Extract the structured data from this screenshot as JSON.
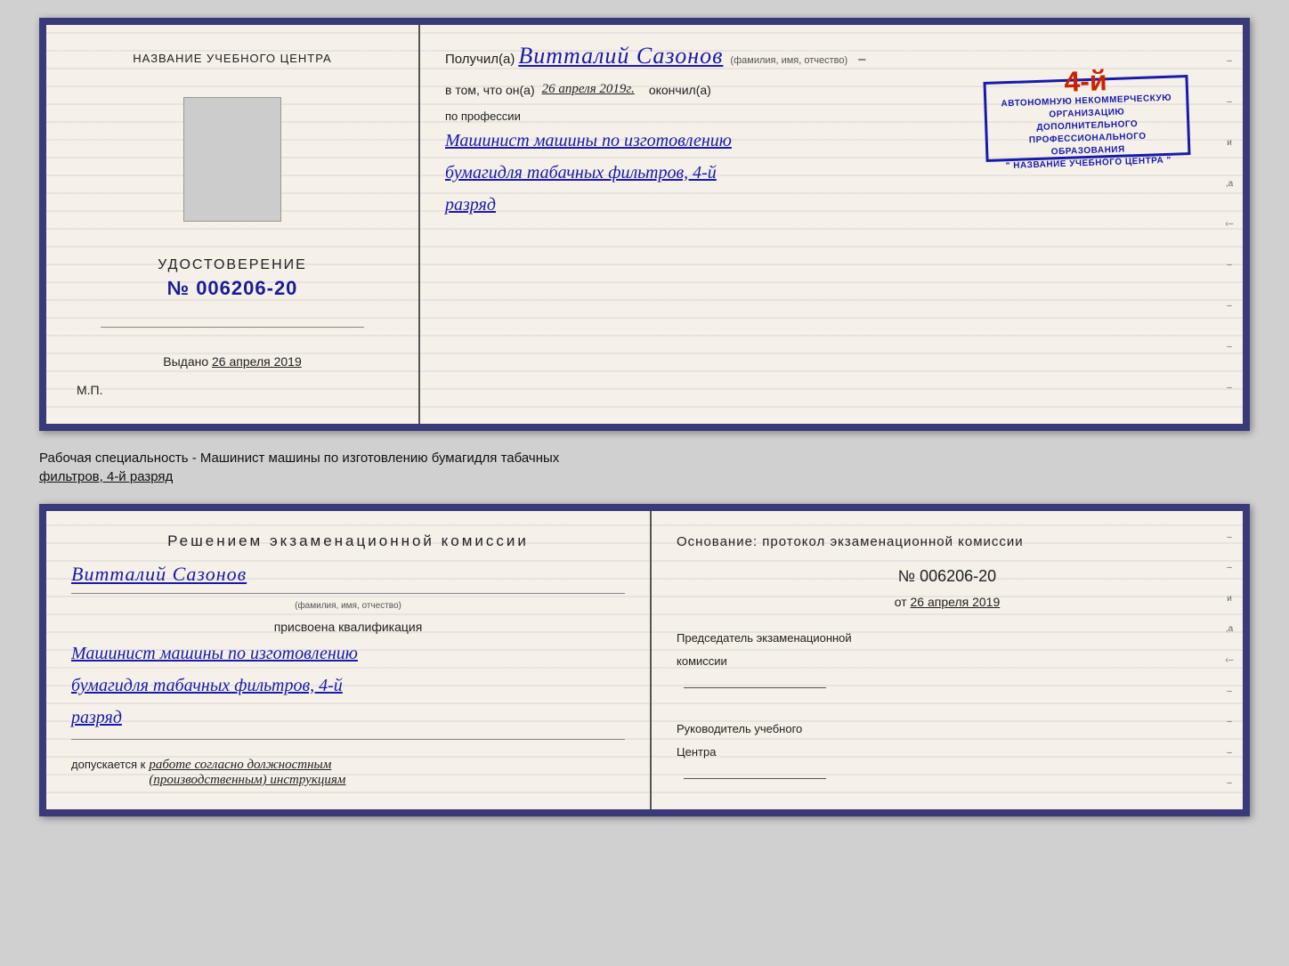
{
  "diploma": {
    "left": {
      "center_title": "НАЗВАНИЕ УЧЕБНОГО ЦЕНТРА",
      "udostoverenie_label": "УДОСТОВЕРЕНИЕ",
      "number": "№ 006206-20",
      "vidano_label": "Выдано",
      "vidano_date": "26 апреля 2019",
      "mp_label": "М.П."
    },
    "right": {
      "poluchil_label": "Получил(а)",
      "name": "Витталий  Сазонов",
      "name_subtitle": "(фамилия, имя, отчество)",
      "vtom_label": "в том, что он(а)",
      "date_text": "26 апреля 2019г.",
      "okonchil_label": "окончил(а)",
      "stamp_number": "4-й",
      "stamp_line1": "АВТОНОМНУЮ НЕКОММЕРЧЕСКУЮ ОРГАНИЗАЦИЮ",
      "stamp_line2": "ДОПОЛНИТЕЛЬНОГО ПРОФЕССИОНАЛЬНОГО ОБРАЗОВАНИЯ",
      "stamp_line3": "\" НАЗВАНИЕ УЧЕБНОГО ЦЕНТРА \"",
      "po_professii_label": "по профессии",
      "profession_line1": "Машинист машины по изготовлению",
      "profession_line2": "бумагидля табачных фильтров, 4-й",
      "profession_line3": "разряд"
    }
  },
  "description": {
    "text_part1": "Рабочая специальность - Машинист машины по изготовлению бумагидля табачных",
    "text_part2": "фильтров, 4-й разряд"
  },
  "bottom": {
    "left": {
      "resheniem_title": "Решением  экзаменационной  комиссии",
      "person_name": "Витталий Сазонов",
      "name_subtitle": "(фамилия, имя, отчество)",
      "prisvoena_label": "присвоена квалификация",
      "profession_line1": "Машинист машины по изготовлению",
      "profession_line2": "бумагидля табачных фильтров, 4-й",
      "profession_line3": "разряд",
      "dopuskaetsya_label": "допускается к",
      "dopuskaetsya_value": "работе согласно должностным",
      "dopuskaetsya_value2": "(производственным) инструкциям"
    },
    "right": {
      "osnovaniye_label": "Основание: протокол экзаменационной  комиссии",
      "nomer": "№  006206-20",
      "ot_label": "от",
      "ot_date": "26 апреля 2019",
      "predsedatel_label": "Председатель экзаменационной",
      "predsedatel_label2": "комиссии",
      "rukovoditel_label": "Руководитель учебного",
      "rukovoditel_label2": "Центра"
    }
  },
  "edge_marks": [
    "–",
    "–",
    "и",
    ",а",
    "‹–",
    "–",
    "–",
    "–",
    "–"
  ]
}
